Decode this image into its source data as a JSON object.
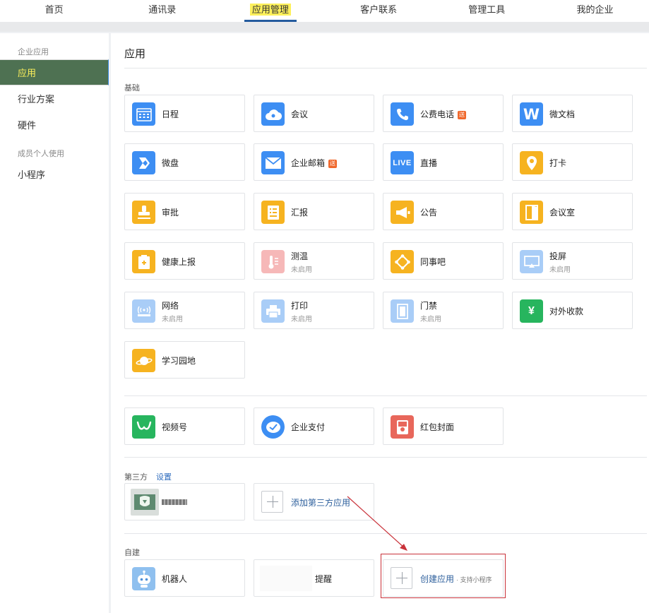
{
  "topnav": {
    "items": [
      "首页",
      "通讯录",
      "应用管理",
      "客户联系",
      "管理工具",
      "我的企业"
    ],
    "active_index": 2
  },
  "sidebar": {
    "group1": "企业应用",
    "items1": [
      "应用",
      "行业方案",
      "硬件"
    ],
    "group2": "成员个人使用",
    "items2": [
      "小程序"
    ]
  },
  "main": {
    "title": "应用",
    "basic_label": "基础",
    "basic_apps": [
      {
        "name": "日程",
        "icon": "calendar-icon"
      },
      {
        "name": "会议",
        "icon": "cloud-meeting-icon"
      },
      {
        "name": "公费电话",
        "icon": "phone-icon",
        "badge": "送"
      },
      {
        "name": "微文档",
        "icon": "w-doc-icon",
        "glyph": "W"
      },
      {
        "name": "微盘",
        "icon": "drive-icon"
      },
      {
        "name": "企业邮箱",
        "icon": "mail-icon",
        "badge": "送"
      },
      {
        "name": "直播",
        "icon": "live-icon",
        "glyph": "LIVE"
      },
      {
        "name": "打卡",
        "icon": "location-pin-icon"
      },
      {
        "name": "审批",
        "icon": "stamp-icon"
      },
      {
        "name": "汇报",
        "icon": "report-icon"
      },
      {
        "name": "公告",
        "icon": "megaphone-icon"
      },
      {
        "name": "会议室",
        "icon": "door-icon"
      },
      {
        "name": "健康上报",
        "icon": "health-clipboard-icon"
      },
      {
        "name": "测温",
        "icon": "thermometer-icon",
        "sub": "未启用"
      },
      {
        "name": "同事吧",
        "icon": "colleague-icon"
      },
      {
        "name": "投屏",
        "icon": "screencast-icon",
        "sub": "未启用"
      },
      {
        "name": "网络",
        "icon": "wifi-router-icon",
        "sub": "未启用"
      },
      {
        "name": "打印",
        "icon": "printer-icon",
        "sub": "未启用"
      },
      {
        "name": "门禁",
        "icon": "access-door-icon",
        "sub": "未启用"
      },
      {
        "name": "对外收款",
        "icon": "yuan-shield-icon",
        "glyph": "¥"
      },
      {
        "name": "学习园地",
        "icon": "planet-icon"
      }
    ],
    "extra_apps": [
      {
        "name": "视频号",
        "icon": "channels-icon"
      },
      {
        "name": "企业支付",
        "icon": "pay-icon"
      },
      {
        "name": "红包封面",
        "icon": "red-envelope-icon"
      }
    ],
    "third_label": "第三方",
    "third_settings": "设置",
    "add_third": "添加第三方应用",
    "self_label": "自建",
    "robot": "机器人",
    "reminder": "提醒",
    "create_app": "创建应用",
    "create_hint": "· 支持小程序"
  },
  "colors": {
    "active_sidebar": "#4e7152",
    "highlight": "#fdf05b",
    "accent": "#245b9e",
    "annotation": "#c9323a"
  }
}
